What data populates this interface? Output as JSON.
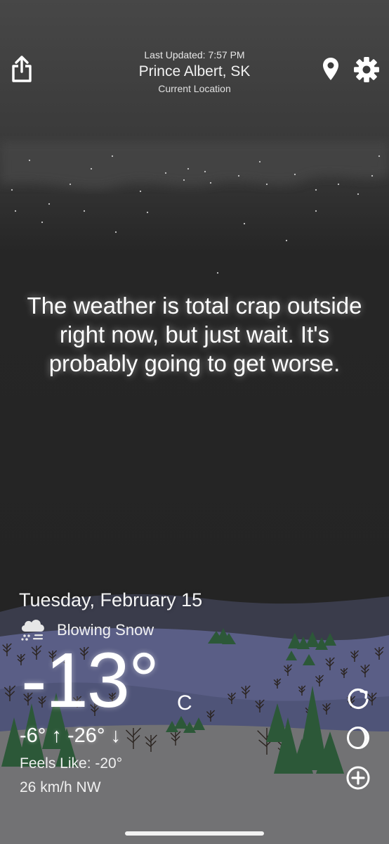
{
  "header": {
    "last_updated": "Last Updated: 7:57 PM",
    "city": "Prince Albert, SK",
    "location_label": "Current Location"
  },
  "message": "The weather is total crap outside right now, but just wait. It's probably going to get worse.",
  "current": {
    "date": "Tuesday, February 15",
    "condition": "Blowing Snow",
    "condition_icon": "cloud-snow-icon",
    "temperature": "-13°",
    "unit": "C",
    "high_low": "-6° ↑  -26° ↓",
    "feels_like": "Feels Like: -20°",
    "wind": "26 km/h NW"
  },
  "icons": {
    "share": "share-icon",
    "location": "location-pin-icon",
    "settings": "gear-icon",
    "refresh": "refresh-icon",
    "moon": "moon-icon",
    "add": "add-icon"
  },
  "colors": {
    "sky_top": "#3d3d3d",
    "sky_bottom": "#242424",
    "hills_far": "#3b3d4c",
    "hills_near": "#5a5f86",
    "ground": "#6f6f73",
    "tree_green": "#2c5838"
  }
}
